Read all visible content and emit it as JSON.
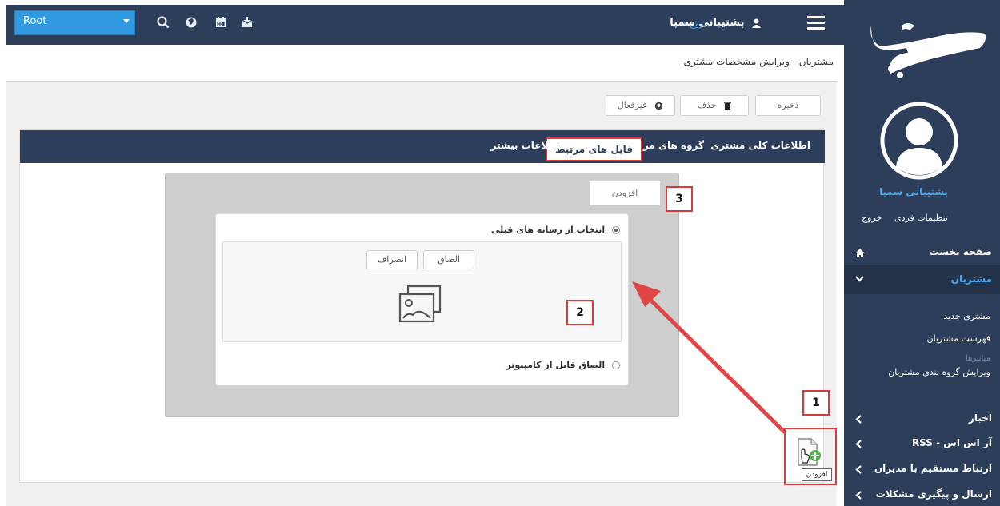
{
  "topbar": {
    "root_select_value": "Root",
    "user_name": "پشتیبانی سمپا",
    "logout_label": "خروج",
    "icons": [
      "search-icon",
      "globe-icon",
      "calendar-icon",
      "inbox-icon",
      "user-icon",
      "hamburger-icon"
    ]
  },
  "breadcrumb": "مشتریان - ویرایش مشخصات مشتری",
  "toolbar": {
    "save_label": "ذخیره",
    "delete_label": "حذف",
    "deactivate_label": "غیرفعال"
  },
  "tabs": [
    {
      "label": "اطلاعات کلی مشتری"
    },
    {
      "label": "گروه های مرتبط"
    },
    {
      "label": "فایل های مرتبط"
    },
    {
      "label": "اطلاعات بیشتر"
    }
  ],
  "media_panel": {
    "add_tab_label": "افزودن",
    "option_previous_label": "انتخاب از رسانه های قبلی",
    "attach_button_label": "الصاق",
    "cancel_button_label": "انصراف",
    "option_upload_label": "الصاق فایل از کامپیوتر"
  },
  "annotations": {
    "badge_1": "1",
    "badge_2": "2",
    "badge_3": "3",
    "tooltip_label": "افزودن"
  },
  "sidebar": {
    "user_name": "پشتیبانی سمپا",
    "personal_settings_label": "تنظیمات فردی",
    "logout_label": "خروج",
    "menu": [
      {
        "label": "صفحه نخست"
      },
      {
        "label": "مشتریان"
      },
      {
        "label": "اخبار"
      },
      {
        "label": "آر اس اس - RSS"
      },
      {
        "label": "ارتباط مستقیم با مدیران"
      },
      {
        "label": "ارسال و پیگیری مشکلات"
      }
    ],
    "customers_submenu": [
      "مشتری جدید",
      "فهرست مشتریان",
      "میانبرها",
      "ویرایش گروه بندی مشتریان"
    ]
  },
  "colors": {
    "navy": "#2d3e5a",
    "accent_blue": "#2f9ae0",
    "link_blue": "#4aa8f0",
    "highlight_red": "#d93a3a"
  }
}
